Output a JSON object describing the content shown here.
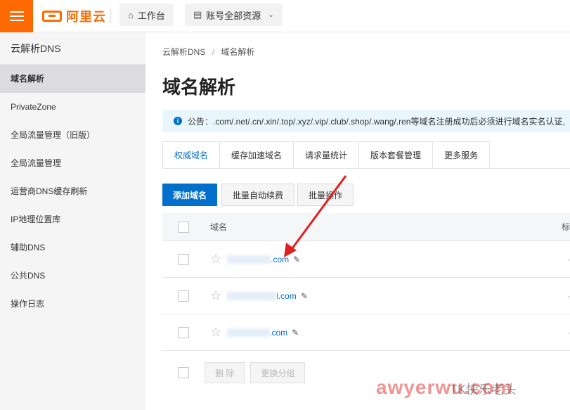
{
  "topbar": {
    "logo_text": "阿里云",
    "workbench_label": "工作台",
    "account_resources_label": "账号全部资源",
    "brand_color": "#ff6a00"
  },
  "sidebar": {
    "title": "云解析DNS",
    "items": [
      {
        "label": "域名解析",
        "active": true
      },
      {
        "label": "PrivateZone"
      },
      {
        "label": "全局流量管理（旧版）"
      },
      {
        "label": "全局流量管理"
      },
      {
        "label": "运营商DNS缓存刷新"
      },
      {
        "label": "IP地理位置库"
      },
      {
        "label": "辅助DNS"
      },
      {
        "label": "公共DNS"
      },
      {
        "label": "操作日志"
      }
    ]
  },
  "breadcrumb": {
    "root": "云解析DNS",
    "sep": "/",
    "current": "域名解析"
  },
  "page_title": "域名解析",
  "notice": {
    "text": "公告：.com/.net/.cn/.xin/.top/.xyz/.vip/.club/.shop/.wang/.ren等域名注册成功后必须进行域名实名认证,"
  },
  "tabs": [
    {
      "label": "权威域名",
      "active": true
    },
    {
      "label": "缓存加速域名"
    },
    {
      "label": "请求量统计"
    },
    {
      "label": "版本套餐管理"
    },
    {
      "label": "更多服务"
    }
  ],
  "actions": {
    "add_domain": "添加域名",
    "batch_renew": "批量自动续费",
    "batch_ops": "批量操作"
  },
  "table": {
    "header_domain": "域名",
    "header_right": "标",
    "rows": [
      {
        "domain_suffix": ".com"
      },
      {
        "domain_suffix": "l.com"
      },
      {
        "domain_suffix": ".com"
      }
    ]
  },
  "footer": {
    "delete": "删 除",
    "change_group": "更换分组"
  },
  "watermark": {
    "text": "awyerwu.com",
    "overlay": "TK快乐老头"
  },
  "colors": {
    "accent": "#0070cc",
    "arrow": "#e02020"
  }
}
